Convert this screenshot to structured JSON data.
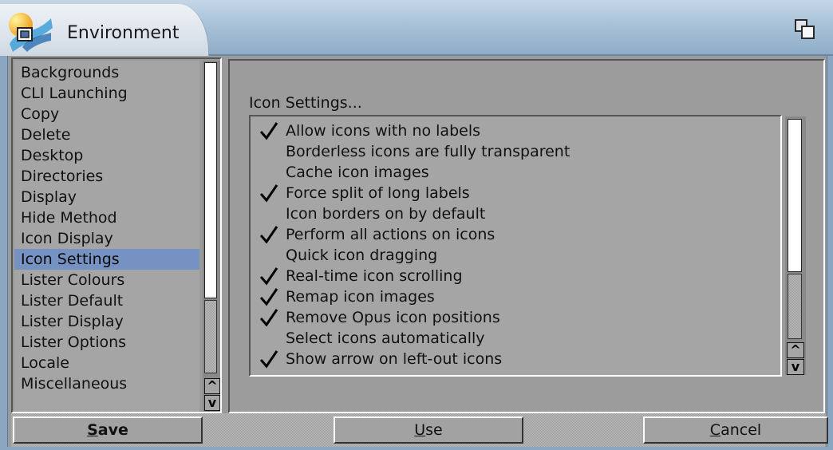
{
  "window": {
    "title": "Environment"
  },
  "categories": {
    "items": [
      "Backgrounds",
      "CLI Launching",
      "Copy",
      "Delete",
      "Desktop",
      "Directories",
      "Display",
      "Hide Method",
      "Icon Display",
      "Icon Settings",
      "Lister Colours",
      "Lister Default",
      "Lister Display",
      "Lister Options",
      "Locale",
      "Miscellaneous"
    ],
    "selected": "Icon Settings"
  },
  "panel": {
    "section_label": "Icon Settings...",
    "options": [
      {
        "label": "Allow icons with no labels",
        "checked": true
      },
      {
        "label": "Borderless icons are fully transparent",
        "checked": false
      },
      {
        "label": "Cache icon images",
        "checked": false
      },
      {
        "label": "Force split of long labels",
        "checked": true
      },
      {
        "label": "Icon borders on by default",
        "checked": false
      },
      {
        "label": "Perform all actions on icons",
        "checked": true
      },
      {
        "label": "Quick icon dragging",
        "checked": false
      },
      {
        "label": "Real-time icon scrolling",
        "checked": true
      },
      {
        "label": "Remap icon images",
        "checked": true
      },
      {
        "label": "Remove Opus icon positions",
        "checked": true
      },
      {
        "label": "Select icons automatically",
        "checked": false
      },
      {
        "label": "Show arrow on left-out icons",
        "checked": true
      }
    ]
  },
  "buttons": {
    "save": {
      "first": "S",
      "rest": "ave"
    },
    "use": {
      "first": "U",
      "rest": "se"
    },
    "cancel": {
      "first": "C",
      "rest": "ancel"
    }
  },
  "scroll_glyphs": {
    "up": "^",
    "down": "v"
  },
  "colors": {
    "selection": "#7692c2",
    "titlebar": "#a9c2d9",
    "background": "#9a9a9a"
  },
  "icons": [
    "app-icon",
    "depth-gadget-icon",
    "checkmark-icon",
    "scroll-up-arrow-icon",
    "scroll-down-arrow-icon"
  ]
}
